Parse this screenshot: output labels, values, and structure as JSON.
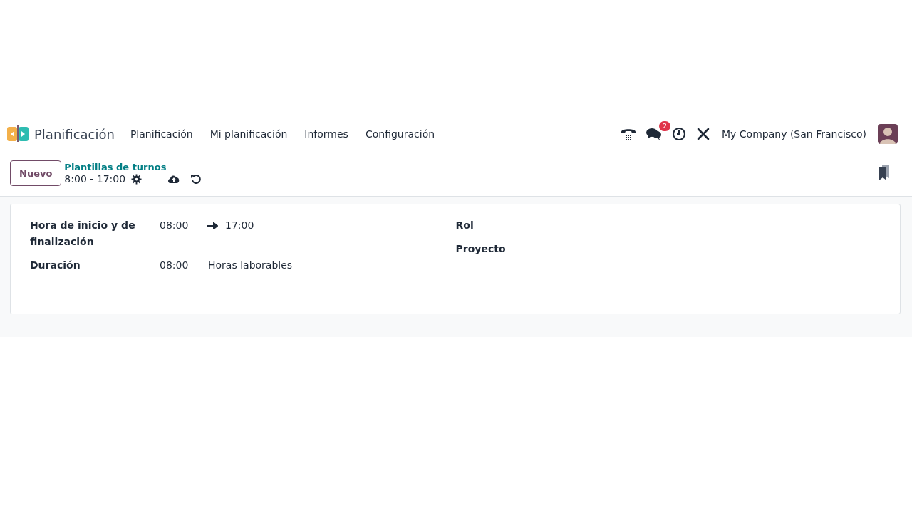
{
  "navbar": {
    "app_name": "Planificación",
    "menu": [
      {
        "label": "Planificación"
      },
      {
        "label": "Mi planificación"
      },
      {
        "label": "Informes"
      },
      {
        "label": "Configuración"
      }
    ],
    "messages_badge": "2",
    "company": "My Company (San Francisco)"
  },
  "control_panel": {
    "new_button": "Nuevo",
    "breadcrumb": "Plantillas de turnos",
    "record_title": "8:00 - 17:00"
  },
  "form": {
    "left": [
      {
        "label": "Hora de inicio y de finalización",
        "kind": "range",
        "value": "08:00",
        "end": "17:00"
      },
      {
        "label": "Duración",
        "kind": "duration",
        "value": "08:00",
        "unit": "Horas laborables"
      }
    ],
    "right": [
      {
        "label": "Rol"
      },
      {
        "label": "Proyecto"
      }
    ]
  }
}
